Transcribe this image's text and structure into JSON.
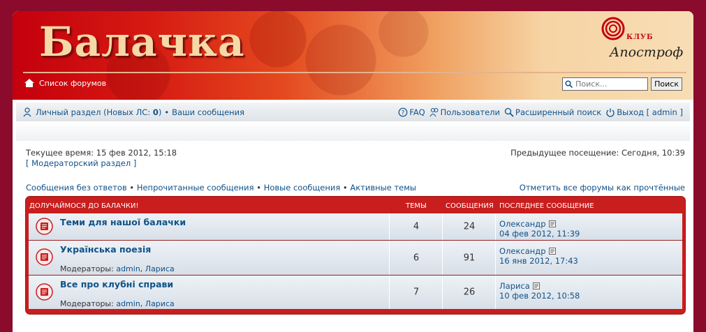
{
  "header": {
    "site_title": "Балачка",
    "logo_klub": "КЛУБ",
    "logo_name": "Апостроф",
    "home_link": "Список форумов",
    "search_placeholder": "Поиск...",
    "search_button": "Поиск"
  },
  "navbar": {
    "personal_prefix": "Личный раздел (Новых ЛС: ",
    "personal_count": "0",
    "personal_suffix": ")",
    "your_posts": "Ваши сообщения",
    "faq": "FAQ",
    "users": "Пользователи",
    "advanced_search": "Расширенный поиск",
    "logout": "Выход [ admin ]"
  },
  "meta": {
    "current_time": "Текущее время: 15 фев 2012, 15:18",
    "moderator_link": "[ Модераторский раздел ]",
    "previous_visit": "Предыдущее посещение: Сегодня, 10:39"
  },
  "links": {
    "unanswered": "Сообщения без ответов",
    "unread": "Непрочитанные сообщения",
    "new_posts": "Новые сообщения",
    "active": "Активные темы",
    "bullet": "•",
    "mark_read": "Отметить все форумы как прочтённые"
  },
  "forum": {
    "category": "ДОЛУЧАЙМОСЯ ДО БАЛАЧКИ!",
    "col_topics": "ТЕМЫ",
    "col_posts": "СООБЩЕНИЯ",
    "col_last": "ПОСЛЕДНЕЕ СООБЩЕНИЕ",
    "moderators_label": "Модераторы:",
    "rows": [
      {
        "title": "Теми для нашої балачки",
        "topics": "4",
        "posts": "24",
        "last_author": "Олександр",
        "last_date": "04 фев 2012, 11:39",
        "moderators": []
      },
      {
        "title": "Українська поезія",
        "topics": "6",
        "posts": "91",
        "last_author": "Олександр",
        "last_date": "16 янв 2012, 17:43",
        "moderators": [
          "admin",
          "Лариса"
        ]
      },
      {
        "title": "Все про клубні справи",
        "topics": "7",
        "posts": "26",
        "last_author": "Лариса",
        "last_date": "10 фев 2012, 10:58",
        "moderators": [
          "admin",
          "Лариса"
        ]
      }
    ]
  },
  "colors": {
    "background": "#8a0b2c",
    "accent_red": "#c81e1e",
    "link": "#105289"
  }
}
